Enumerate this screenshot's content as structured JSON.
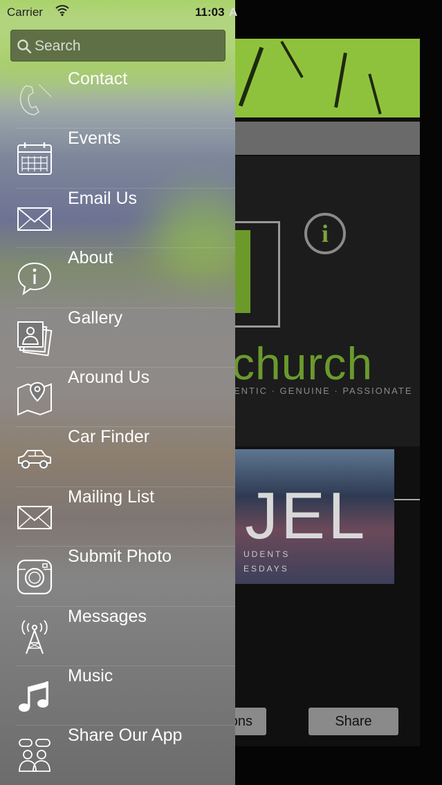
{
  "status_bar": {
    "carrier": "Carrier",
    "time": "11:03",
    "time_tail": "A"
  },
  "search": {
    "placeholder": "Search"
  },
  "menu": [
    {
      "label": "Contact",
      "icon": "phone-icon"
    },
    {
      "label": "Events",
      "icon": "calendar-icon"
    },
    {
      "label": "Email Us",
      "icon": "envelope-icon"
    },
    {
      "label": "About",
      "icon": "info-bubble-icon"
    },
    {
      "label": "Gallery",
      "icon": "photos-icon"
    },
    {
      "label": "Around Us",
      "icon": "map-pin-icon"
    },
    {
      "label": "Car Finder",
      "icon": "car-icon"
    },
    {
      "label": "Mailing List",
      "icon": "envelope-icon"
    },
    {
      "label": "Submit Photo",
      "icon": "camera-icon"
    },
    {
      "label": "Messages",
      "icon": "antenna-icon"
    },
    {
      "label": "Music",
      "icon": "music-note-icon"
    },
    {
      "label": "Share Our App",
      "icon": "people-chat-icon"
    }
  ],
  "background": {
    "brand": "church",
    "tagline": "ENTIC · GENUINE · PASSIONATE",
    "photo_big": "JEL",
    "photo_line1": "UDENTS",
    "photo_line2": "ESDAYS",
    "button_left": "ons",
    "button_right": "Share"
  },
  "colors": {
    "accent": "#8fc23c",
    "drawer_text": "#ffffff"
  }
}
